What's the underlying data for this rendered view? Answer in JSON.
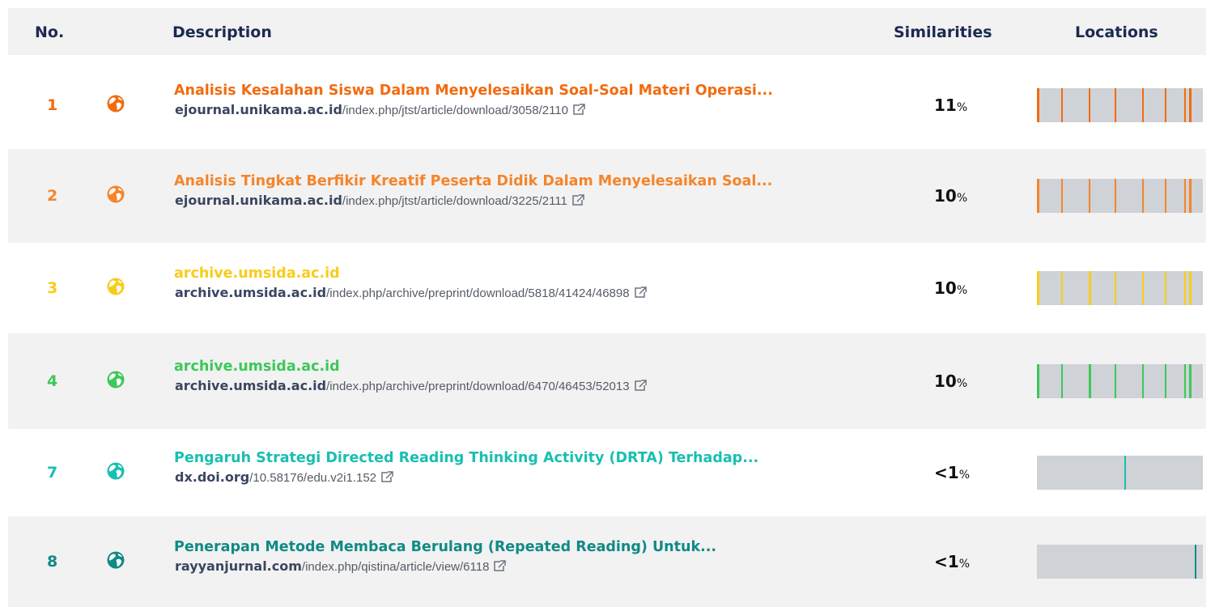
{
  "header": {
    "no": "No.",
    "description": "Description",
    "similarities": "Similarities",
    "locations": "Locations"
  },
  "rows": [
    {
      "no": "1",
      "title": "Analisis Kesalahan Siswa Dalam Menyelesaikan Soal-Soal Materi Operasi...",
      "domain": "ejournal.unikama.ac.id",
      "path": "/index.php/jtst/article/download/3058/2110",
      "similarity": "11",
      "pct": "%",
      "color": "#f26b0f",
      "icon": "globe-icon"
    },
    {
      "no": "2",
      "title": "Analisis Tingkat Berfikir Kreatif Peserta Didik Dalam Menyelesaikan Soal...",
      "domain": "ejournal.unikama.ac.id",
      "path": "/index.php/jtst/article/download/3225/2111",
      "similarity": "10",
      "pct": "%",
      "color": "#f5842a",
      "icon": "globe-icon"
    },
    {
      "no": "3",
      "title": "archive.umsida.ac.id",
      "domain": "archive.umsida.ac.id",
      "path": "/index.php/archive/preprint/download/5818/41424/46898",
      "similarity": "10",
      "pct": "%",
      "color": "#f8cc1b",
      "icon": "globe-icon"
    },
    {
      "no": "4",
      "title": "archive.umsida.ac.id",
      "domain": "archive.umsida.ac.id",
      "path": "/index.php/archive/preprint/download/6470/46453/52013",
      "similarity": "10",
      "pct": "%",
      "color": "#3cc85a",
      "icon": "globe-icon"
    },
    {
      "no": "7",
      "title": "Pengaruh Strategi Directed Reading Thinking Activity (DRTA) Terhadap...",
      "domain": "dx.doi.org",
      "path": "/10.58176/edu.v2i1.152",
      "similarity": "<1",
      "pct": "%",
      "color": "#19bfb2",
      "icon": "globe-icon"
    },
    {
      "no": "8",
      "title": "Penerapan Metode Membaca Berulang (Repeated Reading) Untuk...",
      "domain": "rayyanjurnal.com",
      "path": "/index.php/qistina/article/view/6118",
      "similarity": "<1",
      "pct": "%",
      "color": "#118a86",
      "icon": "globe-icon"
    }
  ],
  "icons": {
    "globe": "globe-icon",
    "external_link": "external-link-icon"
  }
}
